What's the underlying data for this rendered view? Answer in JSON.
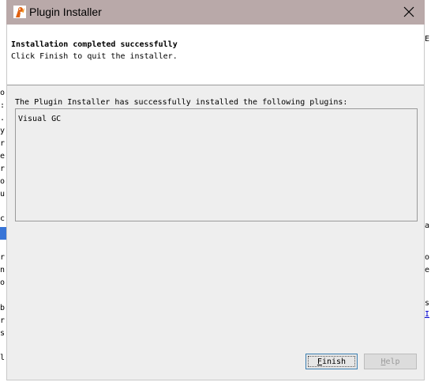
{
  "window": {
    "title": "Plugin Installer",
    "icon": "java-duke-icon",
    "close_icon": "close-icon"
  },
  "header": {
    "title": "Installation completed successfully",
    "subtitle": "Click Finish to quit the installer."
  },
  "body": {
    "info_label": "The Plugin Installer has successfully installed the following plugins:",
    "plugins": [
      "Visual GC"
    ]
  },
  "buttons": {
    "finish": {
      "mnemonic": "F",
      "rest": "inish"
    },
    "help": {
      "mnemonic": "H",
      "rest": "elp",
      "enabled": false
    }
  },
  "background": {
    "left_fragments": [
      "o",
      ":",
      ".",
      "y",
      "r",
      "e",
      "r",
      "o",
      "u",
      "c",
      "r",
      "n",
      "o",
      "b",
      "r",
      "s",
      "l"
    ],
    "right_fragments": [
      "E",
      "a",
      "o",
      "e",
      "s",
      "I"
    ]
  },
  "colors": {
    "titlebar": "#b9a9a9",
    "dialog_bg": "#eeeeee",
    "focus_border": "#3c7fb1",
    "selection": "#3875d7"
  }
}
